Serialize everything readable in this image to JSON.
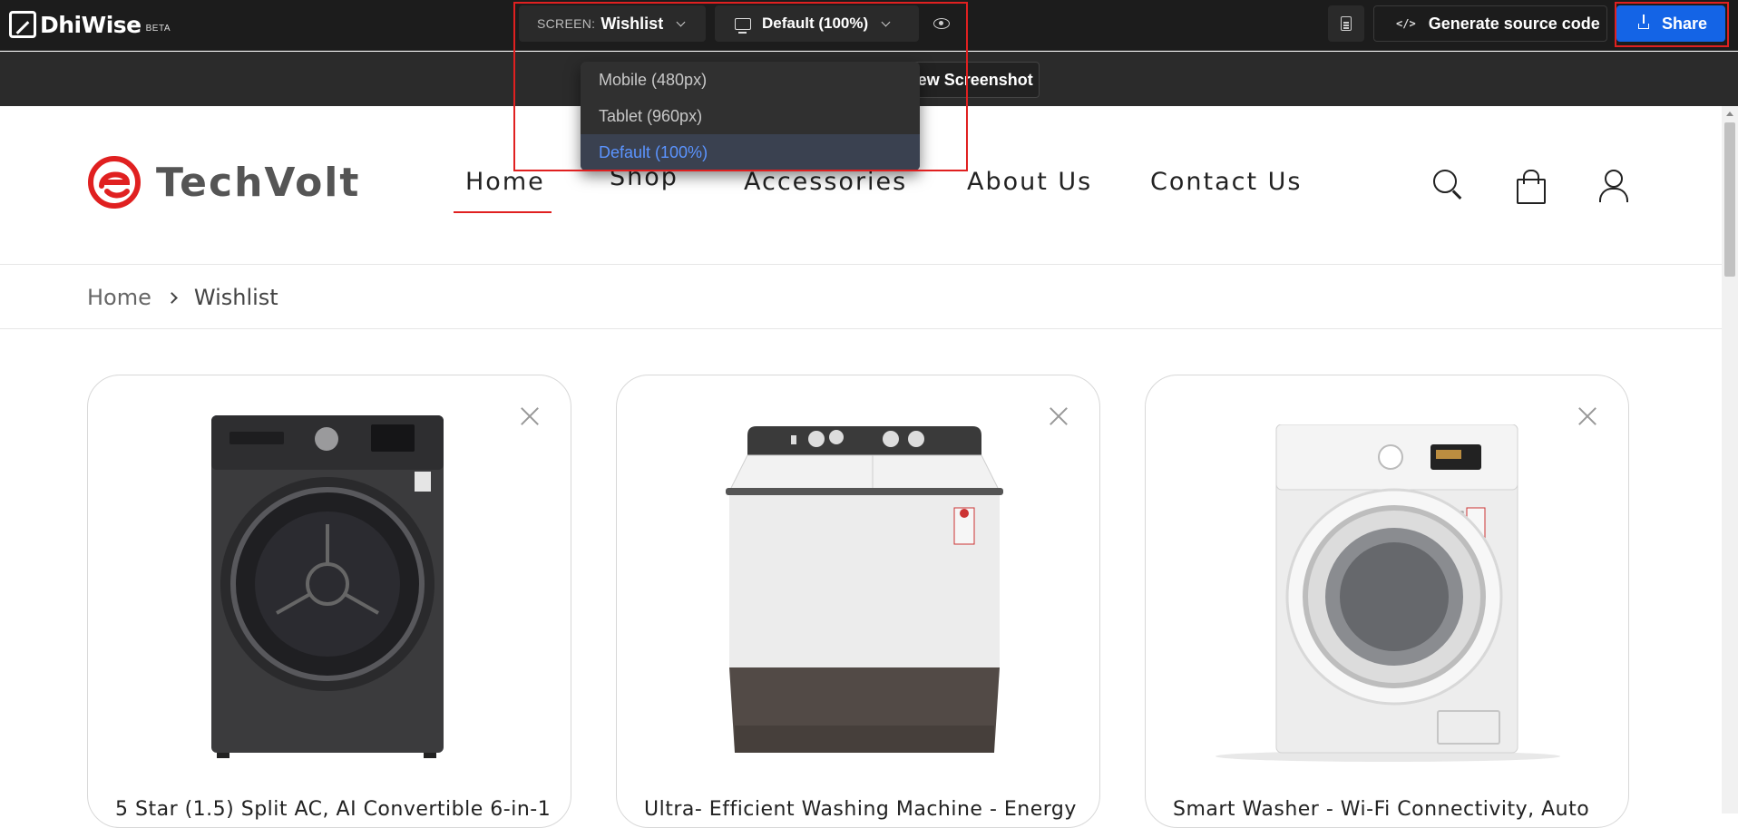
{
  "app": {
    "logo_text": "DhiWise",
    "beta_label": "BETA",
    "screen_label": "SCREEN:",
    "screen_value": "Wishlist",
    "device_value": "Default (100%)",
    "generate_label": "Generate source code",
    "share_label": "Share",
    "view_screenshot_label": "View Screenshot",
    "device_options": [
      "Mobile (480px)",
      "Tablet (960px)",
      "Default (100%)"
    ],
    "selected_device": "Default (100%)",
    "highlight_color": "#e02020",
    "share_color": "#1464e6"
  },
  "site": {
    "brand": "TechVolt",
    "brand_color": "#e02020",
    "nav": [
      "Home",
      "Shop",
      "Accessories",
      "About Us",
      "Contact Us"
    ],
    "active_nav": "Home",
    "breadcrumb": {
      "home": "Home",
      "current": "Wishlist"
    },
    "products": [
      {
        "title": "5 Star (1.5)  Split AC, AI Convertible 6-in-1",
        "image": "dark-front-load-dryer"
      },
      {
        "title": "Ultra- Efficient Washing Machine - Energy",
        "image": "semi-automatic-twin-tub"
      },
      {
        "title": "Smart Washer - Wi-Fi Connectivity, Auto",
        "image": "white-front-load-washer"
      }
    ]
  }
}
